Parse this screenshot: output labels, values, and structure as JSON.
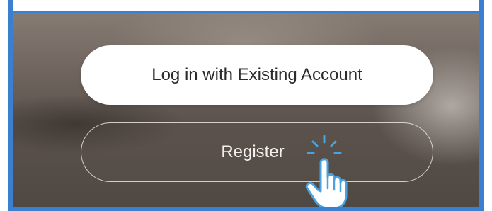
{
  "buttons": {
    "login_label": "Log in with Existing Account",
    "register_label": "Register"
  },
  "icons": {
    "tap_hint": "tap-hand-icon"
  },
  "colors": {
    "frame_accent": "#3b7fd0",
    "login_button_bg": "#ffffff",
    "tap_icon_stroke": "#4aa3e0"
  }
}
